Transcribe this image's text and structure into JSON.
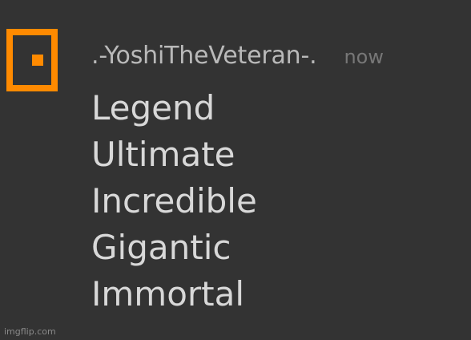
{
  "message": {
    "username": ".-YoshiTheVeteran-.",
    "timestamp": "now",
    "lines": [
      "Legend",
      "Ultimate",
      "Incredible",
      "Gigantic",
      "Immortal"
    ]
  },
  "watermark": "imgflip.com",
  "colors": {
    "background": "#333333",
    "avatar_accent": "#ff8a00",
    "username": "#b9b9b9",
    "timestamp": "#777777",
    "message_text": "#d8d8d8"
  },
  "icons": {
    "avatar": "orange-square-avatar-icon"
  }
}
